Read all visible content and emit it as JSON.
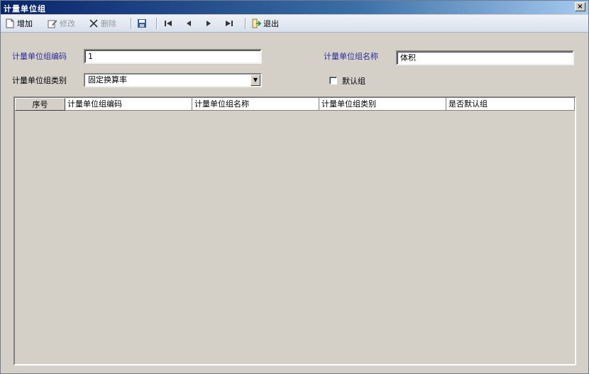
{
  "window": {
    "title": "计量单位组",
    "close_glyph": "×"
  },
  "toolbar": {
    "items": [
      {
        "label": "增加",
        "icon": "new-doc-icon",
        "enabled": true
      },
      {
        "label": "修改",
        "icon": "edit-icon",
        "enabled": false
      },
      {
        "label": "删除",
        "icon": "delete-icon",
        "enabled": false
      },
      {
        "label": "",
        "icon": "save-icon",
        "enabled": true
      },
      {
        "label": "",
        "icon": "first-record-icon",
        "enabled": true
      },
      {
        "label": "",
        "icon": "prev-record-icon",
        "enabled": true
      },
      {
        "label": "",
        "icon": "next-record-icon",
        "enabled": true
      },
      {
        "label": "",
        "icon": "last-record-icon",
        "enabled": true
      },
      {
        "label": "退出",
        "icon": "exit-icon",
        "enabled": true
      }
    ]
  },
  "form": {
    "code_label": "计量单位组编码",
    "code_value": "1",
    "name_label": "计量单位组名称",
    "name_value": "体积",
    "type_label": "计量单位组类别",
    "type_value": "固定换算率",
    "default_label": "默认组",
    "default_checked": false
  },
  "grid": {
    "columns": [
      "序号",
      "计量单位组编码",
      "计量单位组名称",
      "计量单位组类别",
      "是否默认组"
    ],
    "rows": []
  }
}
